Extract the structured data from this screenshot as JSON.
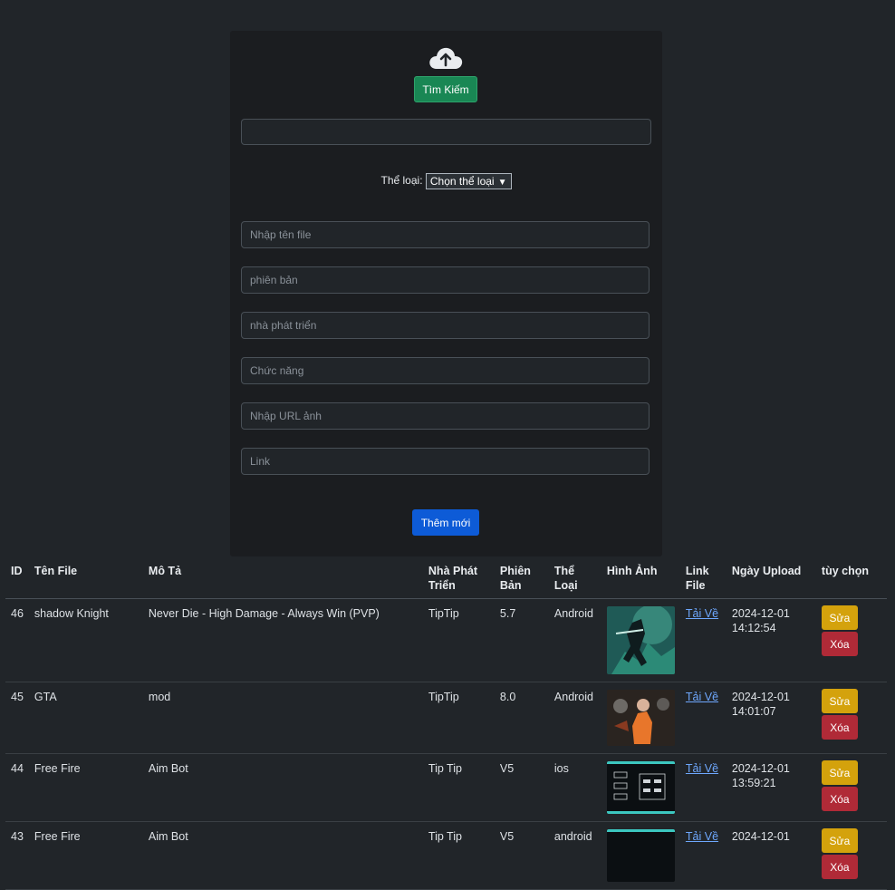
{
  "form": {
    "search_label": "Tìm Kiếm",
    "category_label": "Thể loại:",
    "category_selected": "Chọn thể loại",
    "placeholders": {
      "name": "Nhập tên file",
      "version": "phiên bản",
      "developer": "nhà phát triển",
      "function": "Chức năng",
      "image_url": "Nhập URL ảnh",
      "link": "Link"
    },
    "add_label": "Thêm mới"
  },
  "table": {
    "headers": {
      "id": "ID",
      "name": "Tên File",
      "desc": "Mô Tả",
      "dev": "Nhà Phát Triển",
      "version": "Phiên Bản",
      "category": "Thể Loại",
      "image": "Hình Ảnh",
      "link": "Link File",
      "date": "Ngày Upload",
      "options": "tùy chọn"
    },
    "rows": [
      {
        "id": "46",
        "name": "shadow Knight",
        "desc": "Never Die - High Damage - Always Win (PVP)",
        "dev": "TipTip",
        "version": "5.7",
        "category": "Android",
        "link": "Tải Về",
        "date": "2024-12-01",
        "time": "14:12:54",
        "edit": "Sửa",
        "delete": "Xóa"
      },
      {
        "id": "45",
        "name": "GTA",
        "desc": "mod",
        "dev": "TipTip",
        "version": "8.0",
        "category": "Android",
        "link": "Tải Về",
        "date": "2024-12-01",
        "time": "14:01:07",
        "edit": "Sửa",
        "delete": "Xóa"
      },
      {
        "id": "44",
        "name": "Free Fire",
        "desc": "Aim Bot",
        "dev": "Tip Tip",
        "version": "V5",
        "category": "ios",
        "link": "Tải Về",
        "date": "2024-12-01",
        "time": "13:59:21",
        "edit": "Sửa",
        "delete": "Xóa"
      },
      {
        "id": "43",
        "name": "Free Fire",
        "desc": "Aim Bot",
        "dev": "Tip Tip",
        "version": "V5",
        "category": "android",
        "link": "Tải Về",
        "date": "2024-12-01",
        "time": "",
        "edit": "Sửa",
        "delete": "Xóa"
      }
    ]
  }
}
